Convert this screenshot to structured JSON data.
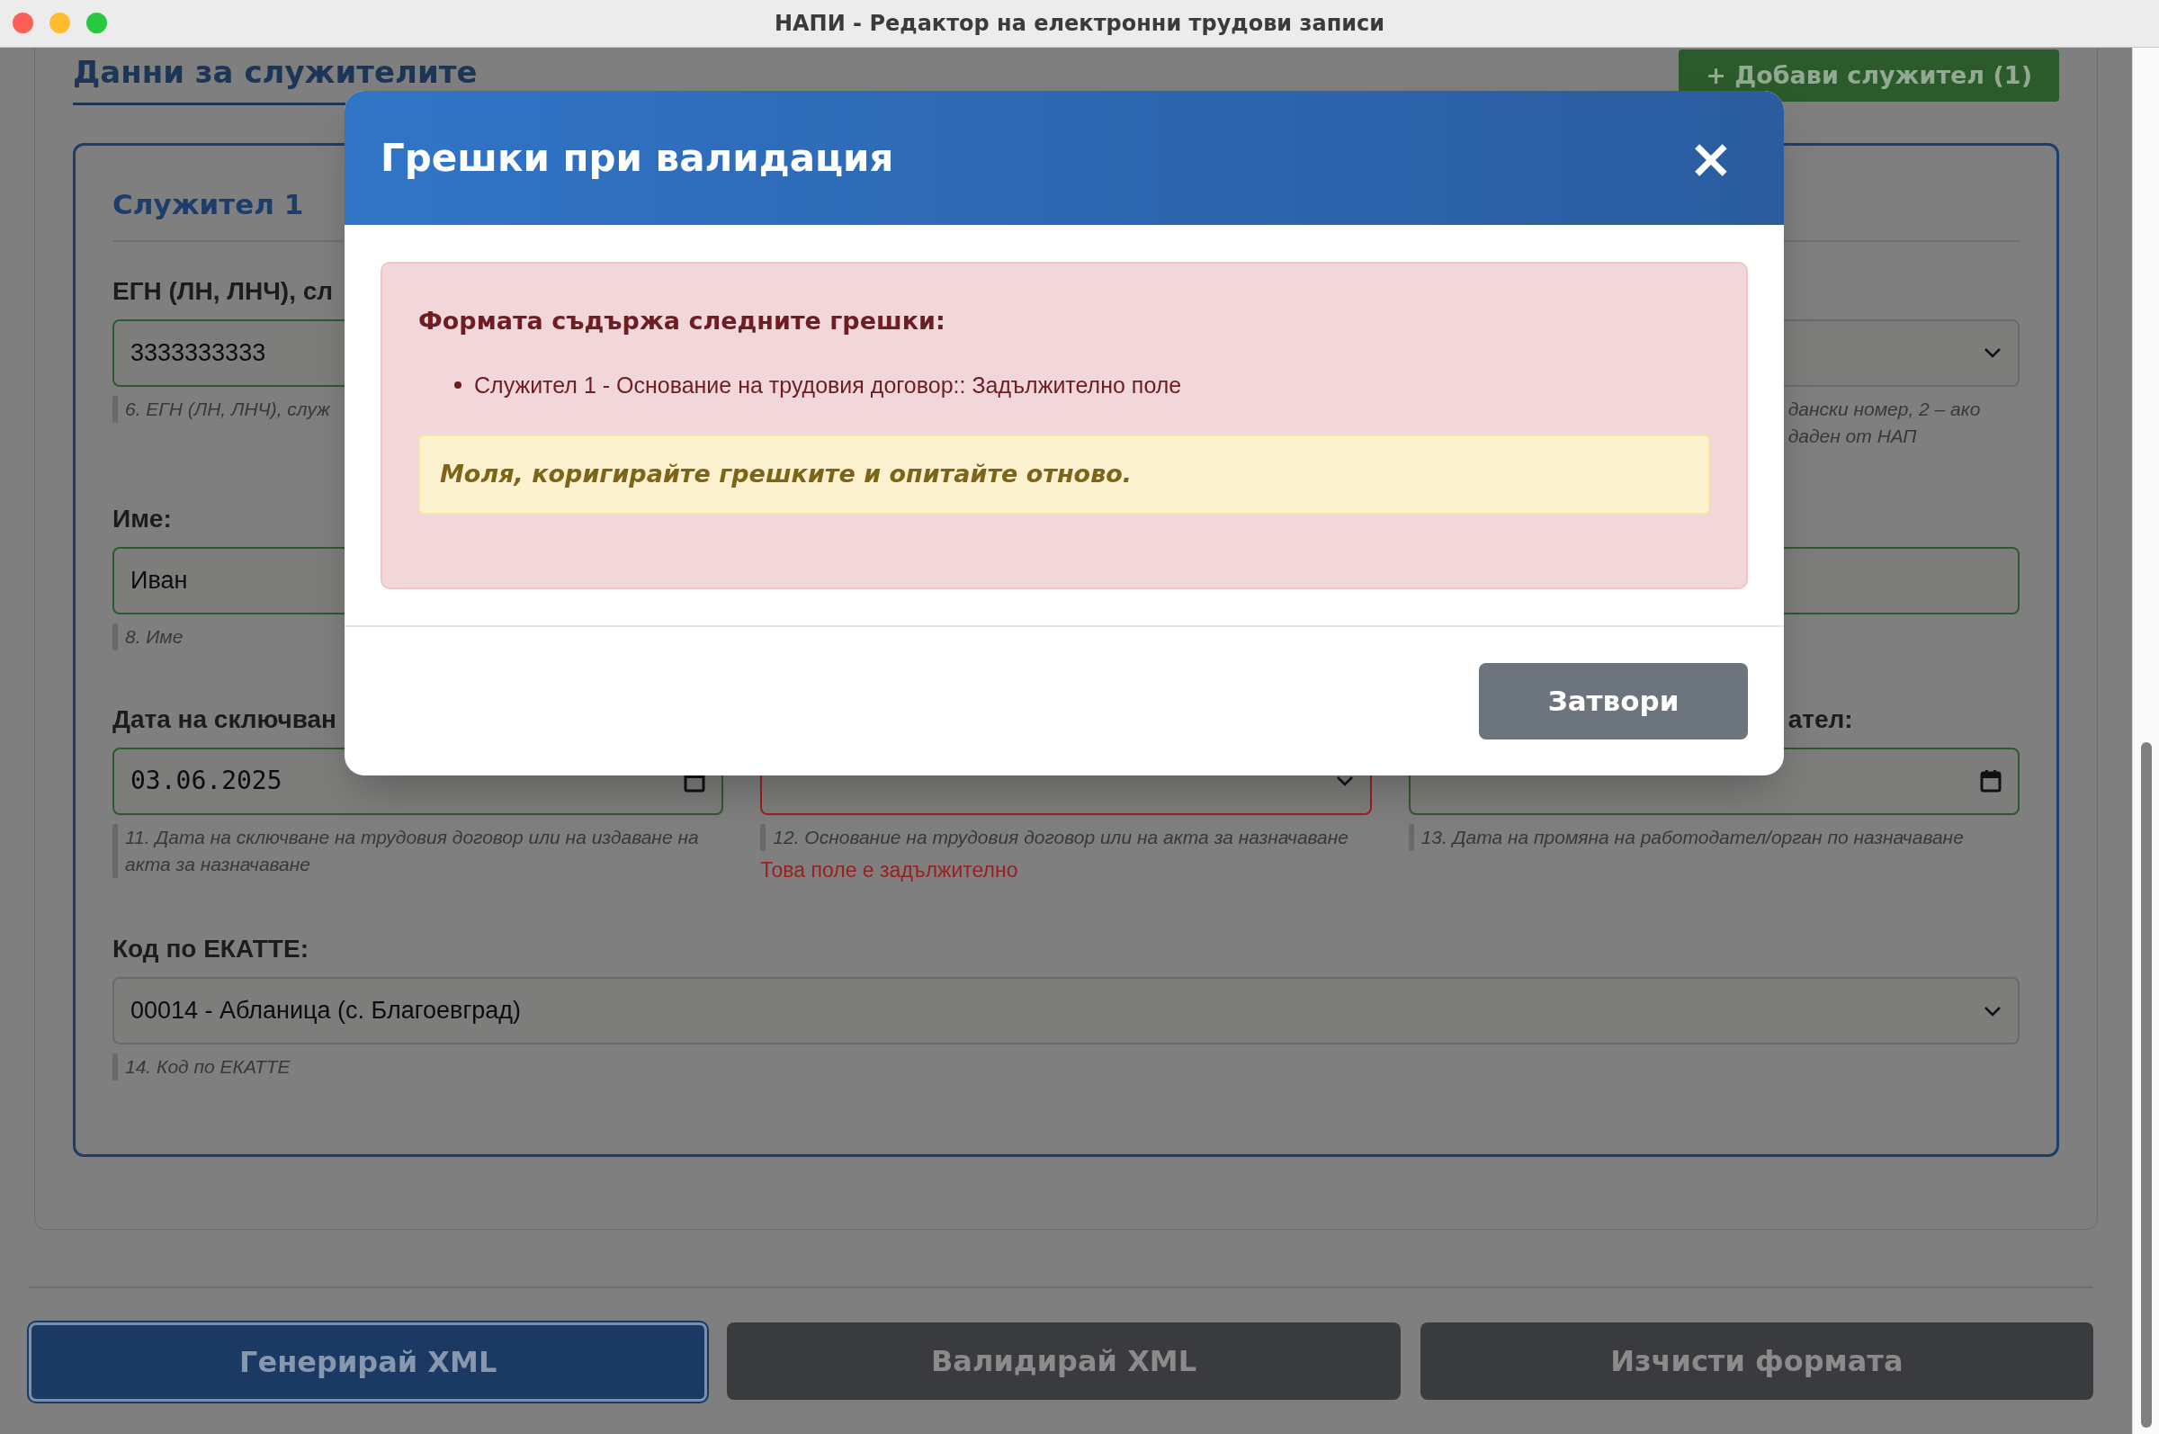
{
  "window": {
    "title": "НАПИ - Редактор на електронни трудови записи"
  },
  "section": {
    "title": "Данни за служителите",
    "add_button": "+ Добави служител (1)"
  },
  "employee": {
    "title": "Служител 1",
    "rows": [
      {
        "cells": [
          {
            "kind": "text",
            "label": "ЕГН (ЛН, ЛНЧ), сл",
            "value": "3333333333",
            "valid": true,
            "invalid": false,
            "hint": "6. ЕГН (ЛН, ЛНЧ), служ"
          },
          null,
          {
            "kind": "select",
            "valid": false,
            "invalid": false,
            "hint_tail": [
              "дански номер, 2 – ако",
              "даден от НАП"
            ]
          }
        ]
      },
      {
        "cells": [
          {
            "kind": "text",
            "label": "Име:",
            "value": "Иван",
            "valid": true,
            "invalid": false,
            "hint": "8. Име"
          },
          null,
          {
            "kind": "text",
            "valid": true,
            "invalid": false
          }
        ]
      },
      {
        "cells": [
          {
            "kind": "date",
            "label": "Дата на сключван",
            "value": "03.06.2025",
            "valid": true,
            "invalid": false,
            "hint": "11. Дата на сключване на трудовия договор или на издаване на акта за назначаване"
          },
          {
            "kind": "select",
            "valid": false,
            "invalid": true,
            "hint": "12. Основание на трудовия договор или на акта за назначаване",
            "error": "Това поле е задължително"
          },
          {
            "kind": "date",
            "label_tail": "ател:",
            "valid": true,
            "invalid": false,
            "hint": "13. Дата на промяна на работодател/орган по назначаване"
          }
        ]
      }
    ],
    "ekatte": {
      "kind": "select",
      "label": "Код по ЕКАТТЕ:",
      "value": "00014 - Абланица (с. Благоевград)",
      "valid": false,
      "invalid": false,
      "hint": "14. Код по ЕКАТТЕ"
    }
  },
  "actions": [
    {
      "label": "Генерирай XML",
      "kind": "primary"
    },
    {
      "label": "Валидирай XML",
      "kind": "secondary"
    },
    {
      "label": "Изчисти формата",
      "kind": "secondary"
    }
  ],
  "modal": {
    "title": "Грешки при валидация",
    "close": "×",
    "alert_title": "Формата съдържа следните грешки:",
    "errors": [
      "Служител 1 - Основание на трудовия договор:: Задължително поле"
    ],
    "notice": "Моля, коригирайте грешките и опитайте отново.",
    "close_button": "Затвори"
  }
}
